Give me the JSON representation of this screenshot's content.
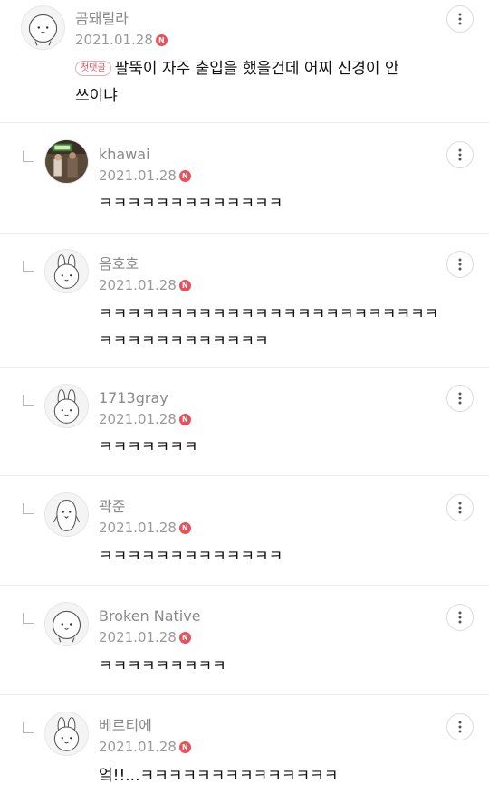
{
  "comments": [
    {
      "author": "곰돼릴라",
      "date": "2021.01.28",
      "new_badge": "N",
      "first_badge": "첫댓글",
      "text": "팔뚝이 자주 출입을 했을건데 어찌 신경이 안쓰이냐",
      "avatar": "bear-avatar-icon"
    },
    {
      "author": "khawai",
      "date": "2021.01.28",
      "new_badge": "N",
      "text": "ㅋㅋㅋㅋㅋㅋㅋㅋㅋㅋㅋㅋㅋ",
      "avatar": "photo-avatar"
    },
    {
      "author": "음호호",
      "date": "2021.01.28",
      "new_badge": "N",
      "text": "ㅋㅋㅋㅋㅋㅋㅋㅋㅋㅋㅋㅋㅋㅋㅋㅋㅋㅋㅋㅋㅋㅋㅋㅋㅋㅋㅋㅋㅋㅋㅋㅋㅋㅋㅋㅋ",
      "avatar": "rabbit-avatar-icon"
    },
    {
      "author": "1713gray",
      "date": "2021.01.28",
      "new_badge": "N",
      "text": "ㅋㅋㅋㅋㅋㅋㅋ",
      "avatar": "rabbit-avatar-icon"
    },
    {
      "author": "곽준",
      "date": "2021.01.28",
      "new_badge": "N",
      "text": "ㅋㅋㅋㅋㅋㅋㅋㅋㅋㅋㅋㅋㅋ",
      "avatar": "penguin-avatar-icon"
    },
    {
      "author": "Broken Native",
      "date": "2021.01.28",
      "new_badge": "N",
      "text": "ㅋㅋㅋㅋㅋㅋㅋㅋㅋ",
      "avatar": "bear-avatar-icon"
    },
    {
      "author": "베르티에",
      "date": "2021.01.28",
      "new_badge": "N",
      "text": "엌!!...ㅋㅋㅋㅋㅋㅋㅋㅋㅋㅋㅋㅋㅋㅋ",
      "avatar": "rabbit-avatar-icon"
    }
  ],
  "colors": {
    "new_badge": "#e8505b",
    "meta_text": "#9a9a9a",
    "divider": "#ebebeb"
  }
}
